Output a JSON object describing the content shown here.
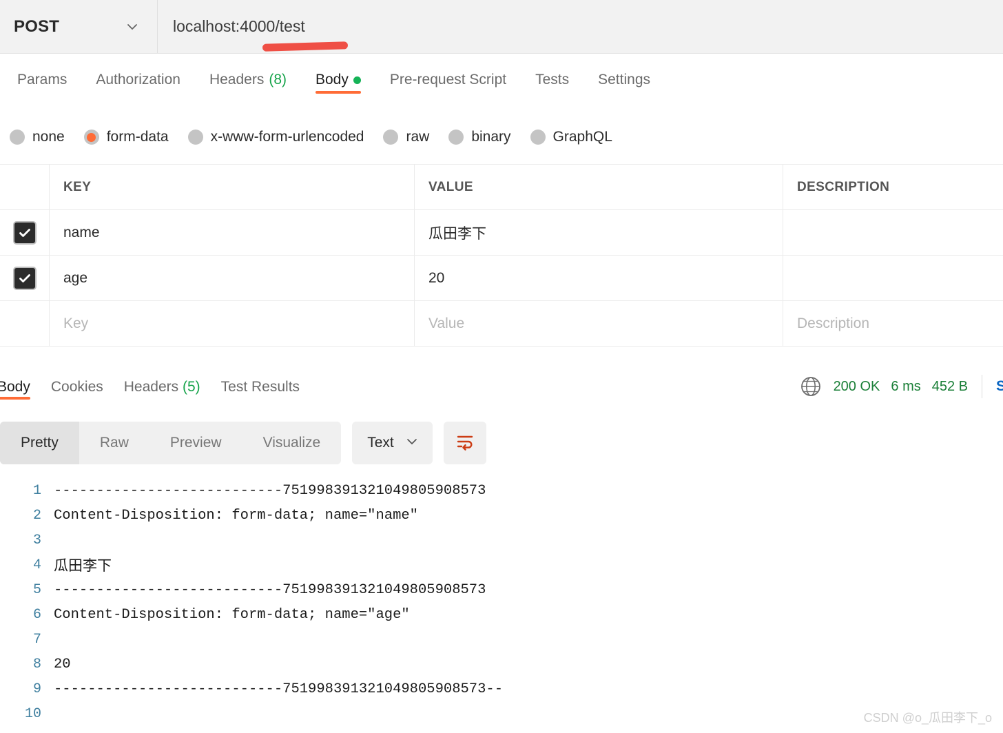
{
  "request": {
    "method": "POST",
    "url": "localhost:4000/test",
    "method_icon": "chevron-down-icon",
    "annotation": "red-underline-mark"
  },
  "request_tabs": [
    {
      "label": "Params",
      "active": false,
      "count": "",
      "dot": false
    },
    {
      "label": "Authorization",
      "active": false,
      "count": "",
      "dot": false
    },
    {
      "label": "Headers",
      "active": false,
      "count": "(8)",
      "dot": false
    },
    {
      "label": "Body",
      "active": true,
      "count": "",
      "dot": true
    },
    {
      "label": "Pre-request Script",
      "active": false,
      "count": "",
      "dot": false
    },
    {
      "label": "Tests",
      "active": false,
      "count": "",
      "dot": false
    },
    {
      "label": "Settings",
      "active": false,
      "count": "",
      "dot": false
    }
  ],
  "body_types": [
    {
      "label": "none",
      "selected": false
    },
    {
      "label": "form-data",
      "selected": true
    },
    {
      "label": "x-www-form-urlencoded",
      "selected": false
    },
    {
      "label": "raw",
      "selected": false
    },
    {
      "label": "binary",
      "selected": false
    },
    {
      "label": "GraphQL",
      "selected": false
    }
  ],
  "table": {
    "headers": {
      "key": "KEY",
      "value": "VALUE",
      "description": "DESCRIPTION"
    },
    "rows": [
      {
        "checked": true,
        "key": "name",
        "value": "瓜田李下",
        "description": ""
      },
      {
        "checked": true,
        "key": "age",
        "value": "20",
        "description": ""
      }
    ],
    "placeholder_row": {
      "key": "Key",
      "value": "Value",
      "description": "Description"
    }
  },
  "response_tabs": [
    {
      "label": "Body",
      "active": true,
      "count": ""
    },
    {
      "label": "Cookies",
      "active": false,
      "count": ""
    },
    {
      "label": "Headers",
      "active": false,
      "count": "(5)"
    },
    {
      "label": "Test Results",
      "active": false,
      "count": ""
    }
  ],
  "status": {
    "icon": "globe-icon",
    "code": "200 OK",
    "time": "6 ms",
    "size": "452 B",
    "save_label": "Save Response",
    "color": "#1a7f37"
  },
  "format_bar": {
    "views": [
      {
        "label": "Pretty",
        "active": true
      },
      {
        "label": "Raw",
        "active": false
      },
      {
        "label": "Preview",
        "active": false
      },
      {
        "label": "Visualize",
        "active": false
      }
    ],
    "content_type": "Text",
    "content_type_icon": "chevron-down-icon",
    "wrap_icon": "word-wrap-icon",
    "wrap_icon_color": "#cc3c14"
  },
  "code_lines": [
    {
      "n": "1",
      "text": "---------------------------751998391321049805908573",
      "cjk": false
    },
    {
      "n": "2",
      "text": "Content-Disposition: form-data; name=\"name\"",
      "cjk": false
    },
    {
      "n": "3",
      "text": "",
      "cjk": false
    },
    {
      "n": "4",
      "text": "瓜田李下",
      "cjk": true
    },
    {
      "n": "5",
      "text": "---------------------------751998391321049805908573",
      "cjk": false
    },
    {
      "n": "6",
      "text": "Content-Disposition: form-data; name=\"age\"",
      "cjk": false
    },
    {
      "n": "7",
      "text": "",
      "cjk": false
    },
    {
      "n": "8",
      "text": "20",
      "cjk": false
    },
    {
      "n": "9",
      "text": "---------------------------751998391321049805908573--",
      "cjk": false
    },
    {
      "n": "10",
      "text": "",
      "cjk": false
    }
  ],
  "watermark": "CSDN @o_瓜田李下_o",
  "colors": {
    "accent": "#ff6c37",
    "success": "#1a7f37",
    "link": "#0b66c3",
    "gutter": "#3f7f9f",
    "annotation": "#ef4136"
  }
}
